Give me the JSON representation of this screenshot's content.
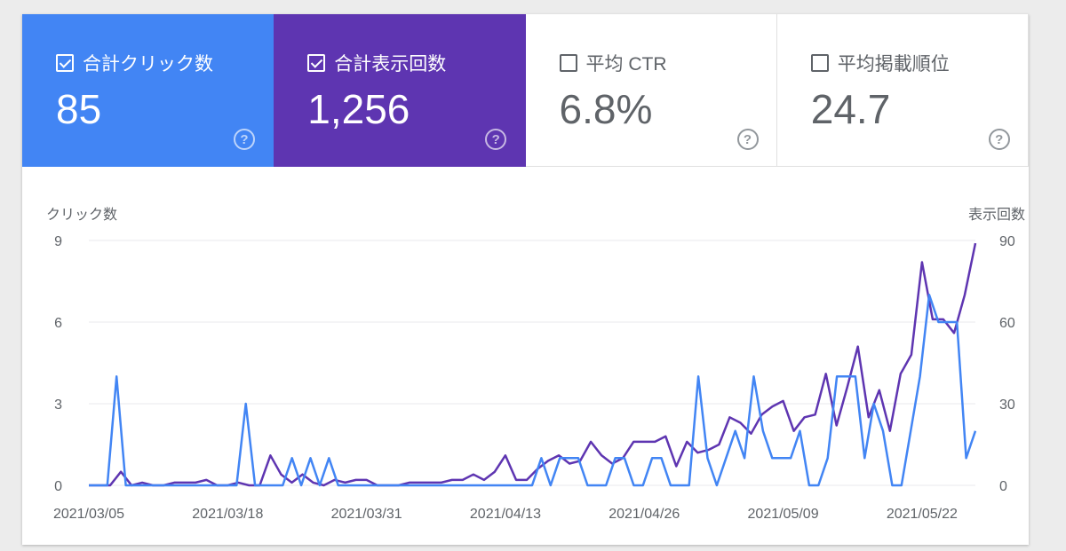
{
  "tiles": [
    {
      "id": "clicks",
      "label": "合計クリック数",
      "value": "85",
      "checked": true,
      "style": "blue"
    },
    {
      "id": "impressions",
      "label": "合計表示回数",
      "value": "1,256",
      "checked": true,
      "style": "purple"
    },
    {
      "id": "ctr",
      "label": "平均 CTR",
      "value": "6.8%",
      "checked": false,
      "style": "white"
    },
    {
      "id": "position",
      "label": "平均掲載順位",
      "value": "24.7",
      "checked": false,
      "style": "white"
    }
  ],
  "help_glyph": "?",
  "colors": {
    "clicks": "#4285f4",
    "impressions": "#5e35b1",
    "axis_text": "#5f6368",
    "grid": "#e8eaed"
  },
  "chart_data": {
    "type": "line",
    "ylabel_left": "クリック数",
    "ylabel_right": "表示回数",
    "ylim_left": [
      0,
      9
    ],
    "ylim_right": [
      0,
      90
    ],
    "yticks_left": [
      "0",
      "3",
      "6",
      "9"
    ],
    "yticks_right": [
      "0",
      "30",
      "60",
      "90"
    ],
    "x_tick_labels": [
      "2021/03/05",
      "2021/03/18",
      "2021/03/31",
      "2021/04/13",
      "2021/04/26",
      "2021/05/09",
      "2021/05/22"
    ],
    "x_start_date": "2021/03/05",
    "grid": true,
    "series": [
      {
        "name": "合計クリック数",
        "axis": "left",
        "values": [
          0,
          0,
          0,
          4,
          0,
          0,
          0,
          0,
          0,
          0,
          0,
          0,
          0,
          0,
          0,
          0,
          0,
          3,
          0,
          0,
          0,
          0,
          1,
          0,
          1,
          0,
          1,
          0,
          0,
          0,
          0,
          0,
          0,
          0,
          0,
          0,
          0,
          0,
          0,
          0,
          0,
          0,
          0,
          0,
          0,
          0,
          0,
          0,
          0,
          1,
          0,
          1,
          1,
          1,
          0,
          0,
          0,
          1,
          1,
          0,
          0,
          1,
          1,
          0,
          0,
          0,
          4,
          1,
          0,
          1,
          2,
          1,
          4,
          2,
          1,
          1,
          1,
          2,
          0,
          0,
          1,
          4,
          4,
          4,
          1,
          3,
          2,
          0,
          0,
          2,
          4,
          7,
          6,
          6,
          6,
          1,
          2
        ]
      },
      {
        "name": "合計表示回数",
        "axis": "right",
        "values": [
          0,
          0,
          0,
          5,
          0,
          1,
          0,
          0,
          1,
          1,
          1,
          2,
          0,
          0,
          1,
          0,
          0,
          11,
          4,
          1,
          4,
          1,
          0,
          2,
          1,
          2,
          2,
          0,
          0,
          0,
          1,
          1,
          1,
          1,
          2,
          2,
          4,
          2,
          5,
          11,
          2,
          2,
          6,
          9,
          11,
          8,
          9,
          16,
          11,
          8,
          10,
          16,
          16,
          16,
          18,
          7,
          16,
          12,
          13,
          15,
          25,
          23,
          19,
          26,
          29,
          31,
          20,
          25,
          26,
          41,
          22,
          36,
          51,
          25,
          35,
          20,
          41,
          48,
          82,
          61,
          61,
          56,
          70,
          89
        ]
      }
    ]
  }
}
